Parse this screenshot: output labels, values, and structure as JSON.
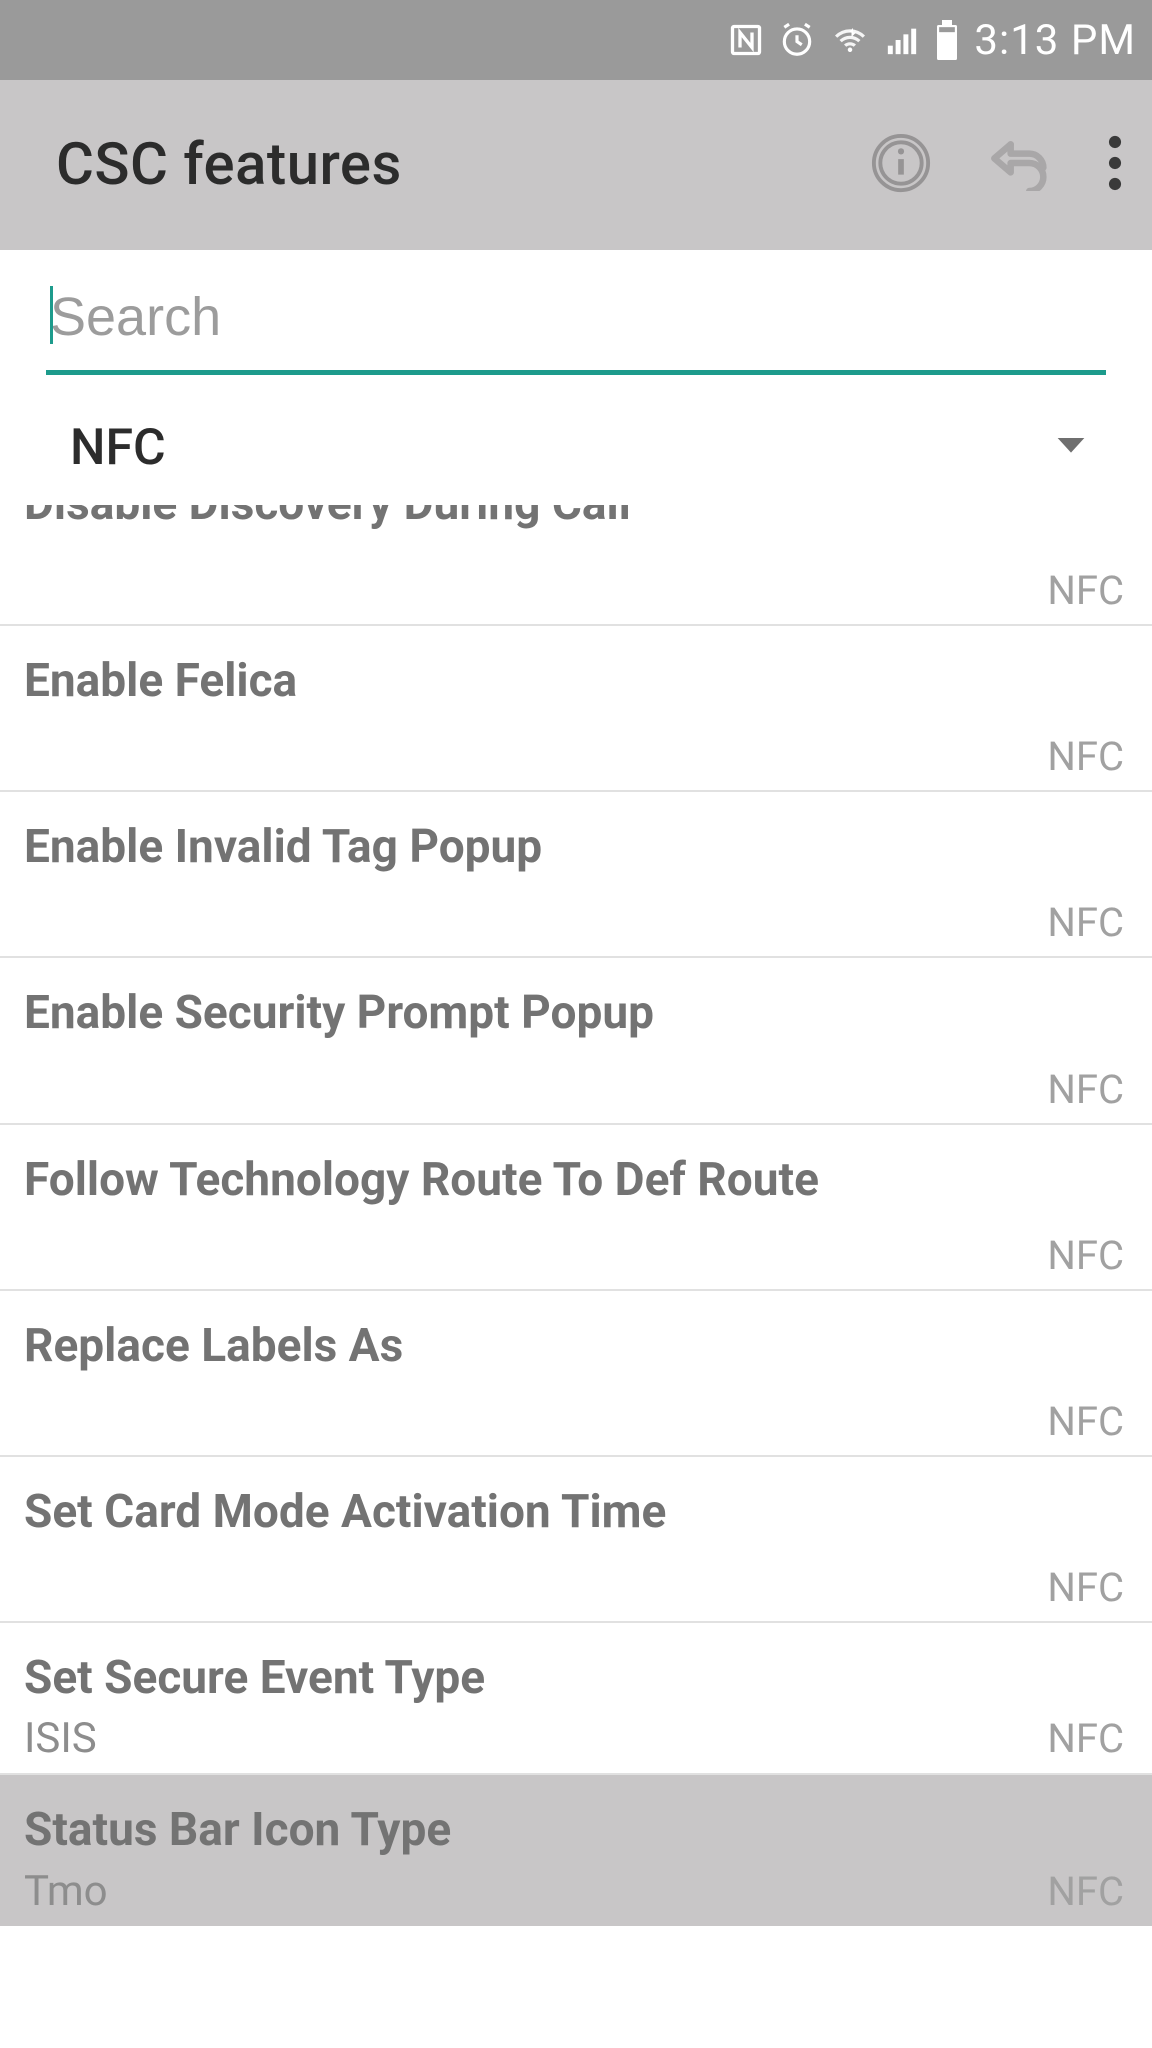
{
  "status": {
    "time": "3:13 PM"
  },
  "appbar": {
    "title": "CSC features"
  },
  "search": {
    "placeholder": "Search",
    "value": ""
  },
  "category": {
    "selected": "NFC"
  },
  "cutoff": {
    "title": "Disable Discovery During Call",
    "tag": "NFC"
  },
  "items": [
    {
      "title": "Enable Felica",
      "value": "",
      "tag": "NFC",
      "highlighted": false
    },
    {
      "title": "Enable Invalid Tag Popup",
      "value": "",
      "tag": "NFC",
      "highlighted": false
    },
    {
      "title": "Enable Security Prompt Popup",
      "value": "",
      "tag": "NFC",
      "highlighted": false
    },
    {
      "title": "Follow Technology Route To Def Route",
      "value": "",
      "tag": "NFC",
      "highlighted": false
    },
    {
      "title": "Replace Labels As",
      "value": "",
      "tag": "NFC",
      "highlighted": false
    },
    {
      "title": "Set Card Mode Activation Time",
      "value": "",
      "tag": "NFC",
      "highlighted": false
    },
    {
      "title": "Set Secure Event Type",
      "value": "ISIS",
      "tag": "NFC",
      "highlighted": false
    },
    {
      "title": "Status Bar Icon Type",
      "value": "Tmo",
      "tag": "NFC",
      "highlighted": true
    }
  ]
}
